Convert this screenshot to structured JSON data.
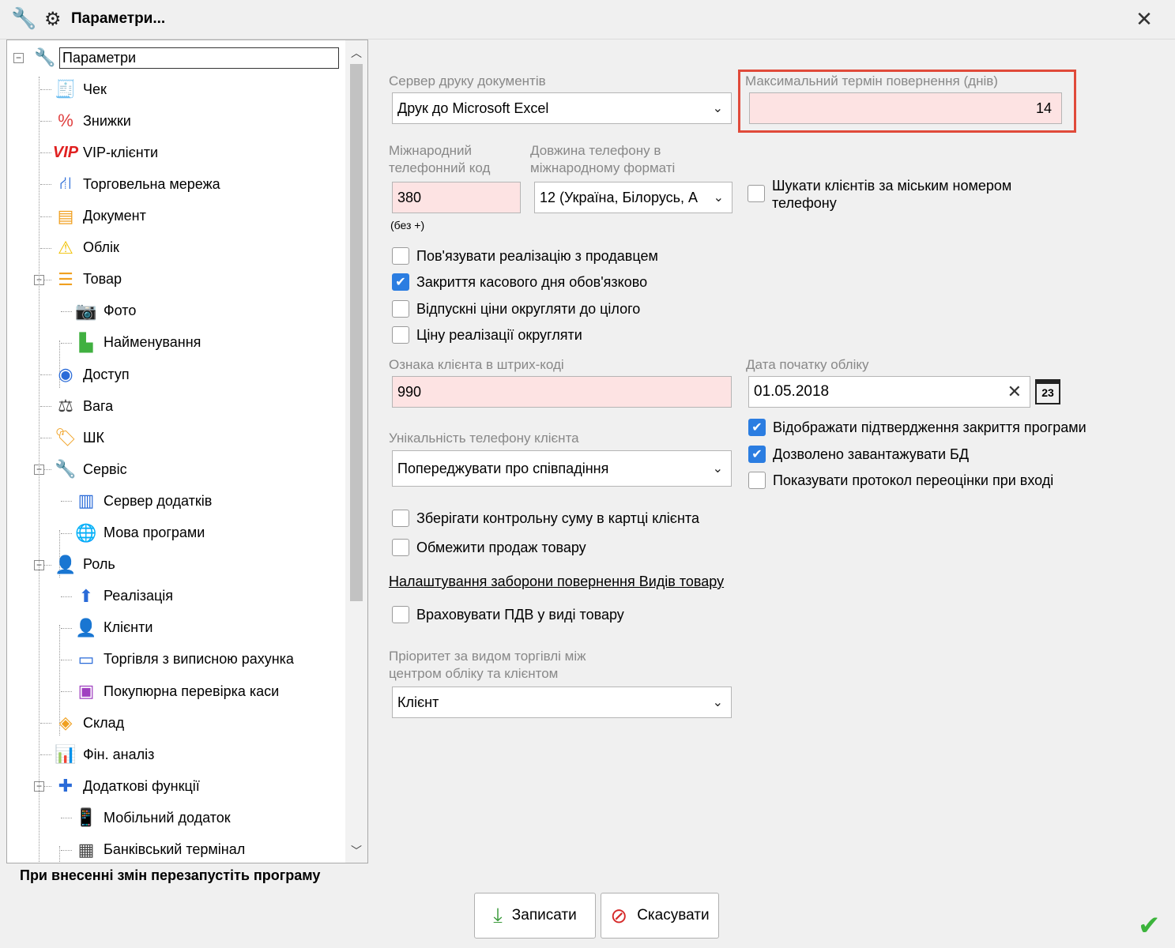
{
  "window": {
    "title": "Параметри...",
    "close_label": "✕"
  },
  "tree": {
    "items": [
      {
        "label": "Параметри",
        "icon": "wrench-icon",
        "glyph": "🔧",
        "color": "#444"
      },
      {
        "label": "Чек",
        "icon": "receipt-icon",
        "glyph": "🧾",
        "color": "#444"
      },
      {
        "label": "Знижки",
        "icon": "percent-icon",
        "glyph": "%",
        "color": "#e04040"
      },
      {
        "label": "VIP-клієнти",
        "icon": "vip-icon",
        "glyph": "VIP",
        "color": "#e02020"
      },
      {
        "label": "Торговельна мережа",
        "icon": "network-icon",
        "glyph": "⛙",
        "color": "#2a6bd8"
      },
      {
        "label": "Документ",
        "icon": "document-icon",
        "glyph": "▤",
        "color": "#f0a020"
      },
      {
        "label": "Облік",
        "icon": "warning-icon",
        "glyph": "⚠",
        "color": "#f0c000"
      },
      {
        "label": "Товар",
        "icon": "list-icon",
        "glyph": "☰",
        "color": "#f0a020"
      },
      {
        "label": "Фото",
        "icon": "camera-icon",
        "glyph": "📷",
        "color": "#444"
      },
      {
        "label": "Найменування",
        "icon": "name-tag-icon",
        "glyph": "▙",
        "color": "#40b040"
      },
      {
        "label": "Доступ",
        "icon": "eye-icon",
        "glyph": "◉",
        "color": "#2a6bd8"
      },
      {
        "label": "Вага",
        "icon": "weight-icon",
        "glyph": "⚖",
        "color": "#444"
      },
      {
        "label": "ШК",
        "icon": "tag-icon",
        "glyph": "🏷",
        "color": "#f0a020"
      },
      {
        "label": "Сервіс",
        "icon": "wrench-icon",
        "glyph": "🔧",
        "color": "#444"
      },
      {
        "label": "Сервер додатків",
        "icon": "server-icon",
        "glyph": "▥",
        "color": "#2a6bd8"
      },
      {
        "label": "Мова програми",
        "icon": "globe-icon",
        "glyph": "🌐",
        "color": "#2a6bd8"
      },
      {
        "label": "Роль",
        "icon": "user-card-icon",
        "glyph": "👤",
        "color": "#2a6bd8"
      },
      {
        "label": "Реалізація",
        "icon": "upload-icon",
        "glyph": "⬆",
        "color": "#2a6bd8"
      },
      {
        "label": "Клієнти",
        "icon": "user-icon",
        "glyph": "👤",
        "color": "#2a6bd8"
      },
      {
        "label": "Торгівля з виписною рахунка",
        "icon": "invoice-icon",
        "glyph": "▭",
        "color": "#2a6bd8"
      },
      {
        "label": "Покупюрна перевірка каси",
        "icon": "cash-register-icon",
        "glyph": "▣",
        "color": "#a040c0"
      },
      {
        "label": "Склад",
        "icon": "layers-icon",
        "glyph": "◈",
        "color": "#f0a020"
      },
      {
        "label": "Фін. аналіз",
        "icon": "finance-chart-icon",
        "glyph": "📊",
        "color": "#2a6bd8"
      },
      {
        "label": "Додаткові функції",
        "icon": "puzzle-icon",
        "glyph": "✚",
        "color": "#2a6bd8"
      },
      {
        "label": "Мобільний додаток",
        "icon": "mobile-icon",
        "glyph": "📱",
        "color": "#444"
      },
      {
        "label": "Банківський термінал",
        "icon": "pos-terminal-icon",
        "glyph": "▦",
        "color": "#444"
      }
    ]
  },
  "footer_note": "При внесенні змін перезапустіть програму",
  "form": {
    "print_server_label": "Сервер друку документів",
    "print_server_value": "Друк до Microsoft Excel",
    "max_return_label": "Максимальний термін повернення (днів)",
    "max_return_value": "14",
    "intl_code_label": "Міжнародний телефонний код",
    "intl_code_value": "380",
    "intl_code_hint": "(без +)",
    "phone_length_label": "Довжина телефону в міжнародному форматі",
    "phone_length_value": "12 (Україна, Білорусь, А",
    "search_by_city_label": "Шукати клієнтів за міським номером телефону",
    "link_seller_label": "Пов'язувати реалізацію з продавцем",
    "close_day_label": "Закриття касового дня обов'язково",
    "round_prices_label": "Відпускні ціни округляти до цілого",
    "round_sale_label": "Ціну реалізації округляти",
    "barcode_sign_label": "Ознака клієнта в штрих-коді",
    "barcode_sign_value": "990",
    "start_date_label": "Дата початку обліку",
    "start_date_value": "01.05.2018",
    "calendar_day": "23",
    "show_close_confirm_label": "Відображати підтвердження закриття програми",
    "allow_db_load_label": "Дозволено завантажувати БД",
    "show_reval_protocol_label": "Показувати протокол переоцінки при вході",
    "phone_unique_label": "Унікальність телефону клієнта",
    "phone_unique_value": "Попереджувати про співпадіння",
    "store_checksum_label": "Зберігати контрольну суму в картці клієнта",
    "limit_sales_label": "Обмежити продаж товару",
    "return_ban_link": "Налаштування заборони повернення Видів товару",
    "vat_label": "Враховувати ПДВ у виді товару",
    "priority_label": "Пріоритет за видом торгівлі між центром обліку та клієнтом",
    "priority_value": "Клієнт"
  },
  "buttons": {
    "save_label": "Записати",
    "cancel_label": "Скасувати"
  },
  "colors": {
    "highlight": "#e04a3a",
    "checkbox_on": "#2b7de1",
    "pink_field": "#fde3e3"
  }
}
